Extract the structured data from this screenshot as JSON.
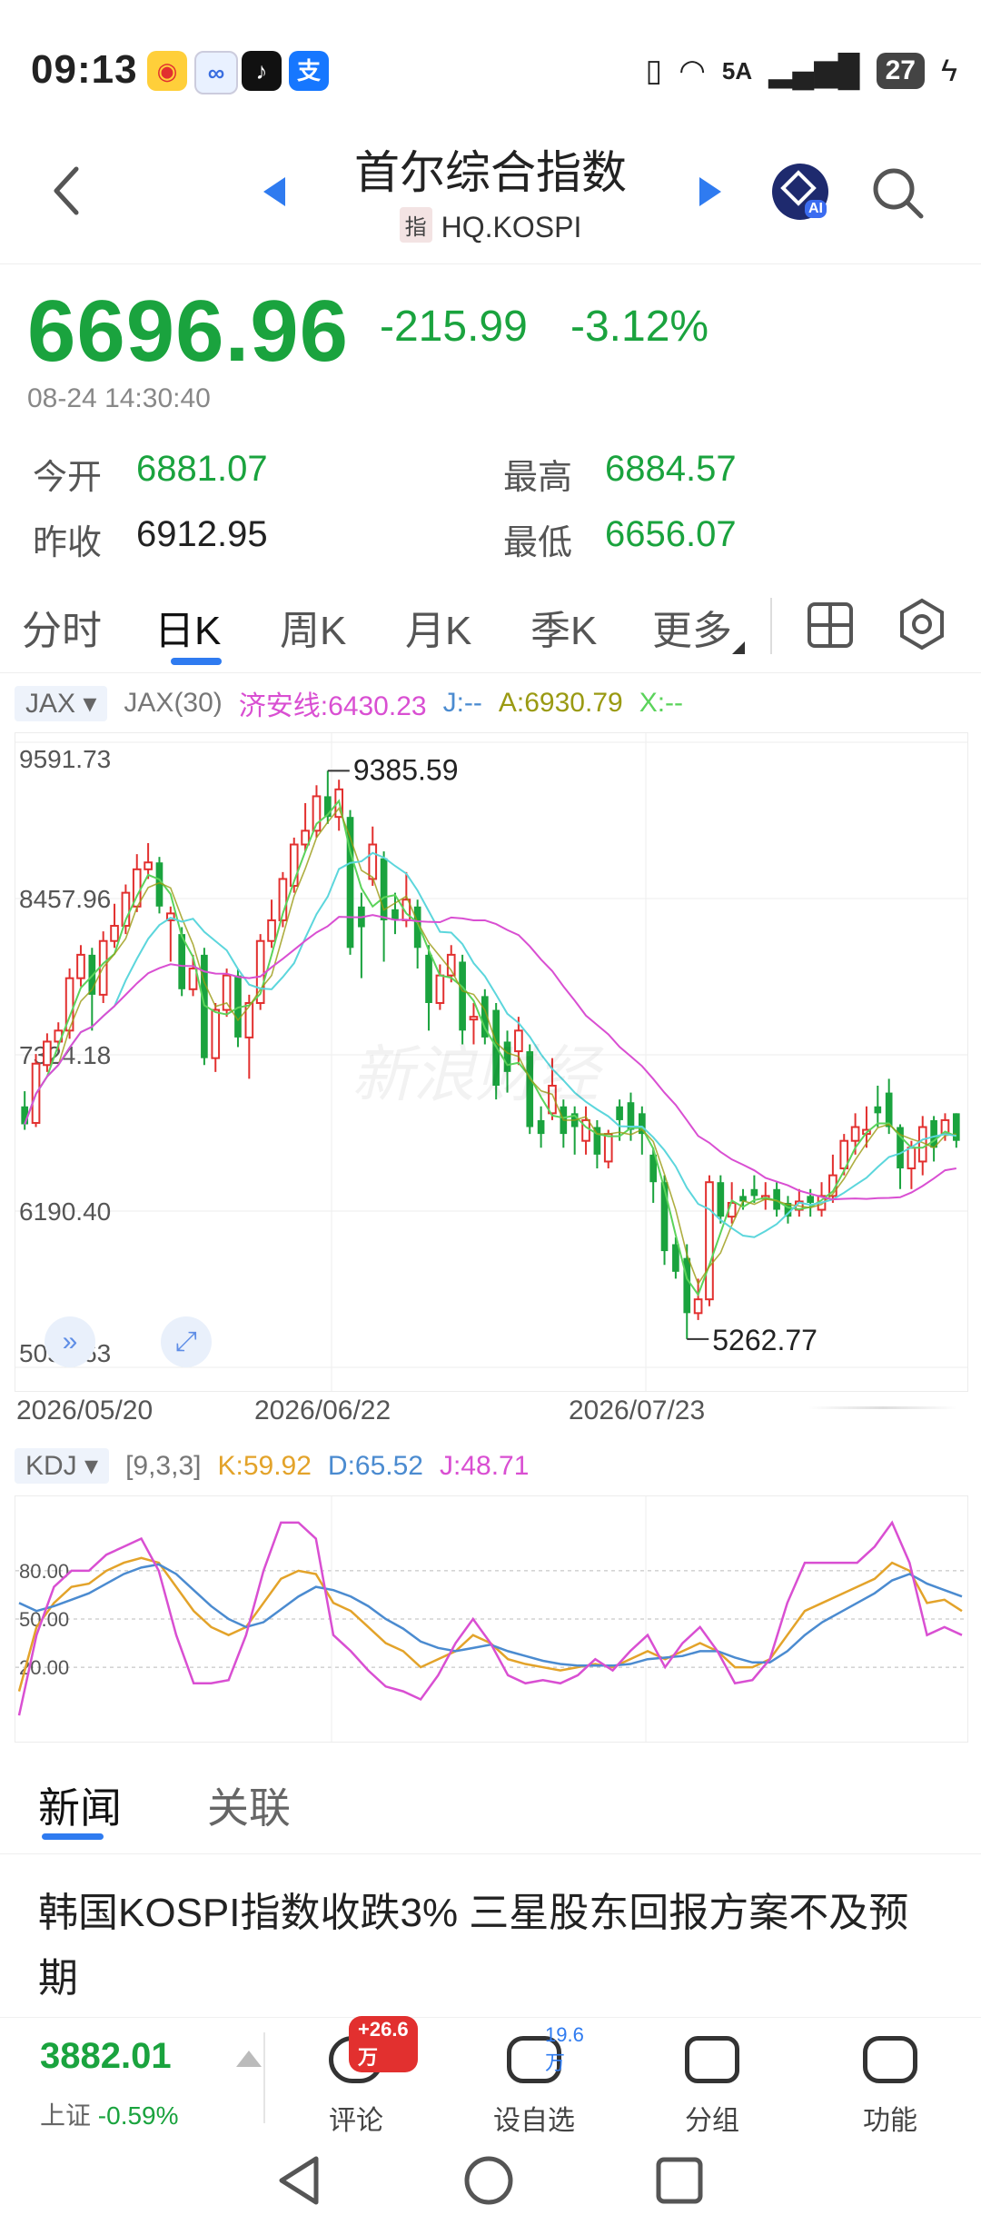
{
  "status": {
    "time": "09:13",
    "network": "5A",
    "battery": "27"
  },
  "header": {
    "title": "首尔综合指数",
    "badge": "指",
    "code": "HQ.KOSPI",
    "ai": "AI"
  },
  "quote": {
    "price": "6696.96",
    "change": "-215.99",
    "change_pct": "-3.12%",
    "datetime": "08-24 14:30:40",
    "open_label": "今开",
    "open": "6881.07",
    "high_label": "最高",
    "high": "6884.57",
    "prev_label": "昨收",
    "prev": "6912.95",
    "low_label": "最低",
    "low": "6656.07"
  },
  "tabs": [
    {
      "label": "分时"
    },
    {
      "label": "日K"
    },
    {
      "label": "周K"
    },
    {
      "label": "月K"
    },
    {
      "label": "季K"
    },
    {
      "label": "更多"
    }
  ],
  "indicator": {
    "name": "JAX ▾",
    "param": "JAX(30)",
    "jian": "济安线:6430.23",
    "j": "J:--",
    "a": "A:6930.79",
    "x": "X:--"
  },
  "kdj": {
    "name": "KDJ ▾",
    "param": "[9,3,3]",
    "k": "K:59.92",
    "d": "D:65.52",
    "j": "J:48.71"
  },
  "chart_data": [
    {
      "type": "candlestick",
      "y_ticks": [
        "9591.73",
        "8457.96",
        "7324.18",
        "6190.40",
        "5056.63"
      ],
      "ylim": [
        5056.63,
        9591.73
      ],
      "x_ticks": [
        "2026/05/20",
        "2026/06/22",
        "2026/07/23"
      ],
      "annotations": [
        "9385.59",
        "5262.77"
      ],
      "series": [
        {
          "o": 6950,
          "c": 6820,
          "h": 7060,
          "l": 6780
        },
        {
          "o": 6830,
          "c": 7260,
          "h": 7330,
          "l": 6800
        },
        {
          "o": 7250,
          "c": 7420,
          "h": 7480,
          "l": 7200
        },
        {
          "o": 7420,
          "c": 7500,
          "h": 7560,
          "l": 7360
        },
        {
          "o": 7500,
          "c": 7880,
          "h": 7950,
          "l": 7440
        },
        {
          "o": 7880,
          "c": 8050,
          "h": 8120,
          "l": 7820
        },
        {
          "o": 8050,
          "c": 7760,
          "h": 8100,
          "l": 7500
        },
        {
          "o": 7760,
          "c": 8150,
          "h": 8220,
          "l": 7700
        },
        {
          "o": 8150,
          "c": 8260,
          "h": 8420,
          "l": 8100
        },
        {
          "o": 8260,
          "c": 8500,
          "h": 8560,
          "l": 8200
        },
        {
          "o": 8400,
          "c": 8670,
          "h": 8780,
          "l": 8360
        },
        {
          "o": 8670,
          "c": 8720,
          "h": 8860,
          "l": 8600
        },
        {
          "o": 8720,
          "c": 8400,
          "h": 8760,
          "l": 8350
        },
        {
          "o": 8300,
          "c": 8350,
          "h": 8400,
          "l": 8000
        },
        {
          "o": 8200,
          "c": 7800,
          "h": 8250,
          "l": 7750
        },
        {
          "o": 7800,
          "c": 7950,
          "h": 8050,
          "l": 7750
        },
        {
          "o": 8050,
          "c": 7300,
          "h": 8100,
          "l": 7250
        },
        {
          "o": 7300,
          "c": 7650,
          "h": 7700,
          "l": 7200
        },
        {
          "o": 7650,
          "c": 7900,
          "h": 7950,
          "l": 7600
        },
        {
          "o": 7900,
          "c": 7450,
          "h": 7950,
          "l": 7380
        },
        {
          "o": 7450,
          "c": 7700,
          "h": 7760,
          "l": 7150
        },
        {
          "o": 7700,
          "c": 8150,
          "h": 8200,
          "l": 7650
        },
        {
          "o": 8150,
          "c": 8300,
          "h": 8450,
          "l": 8100
        },
        {
          "o": 8300,
          "c": 8600,
          "h": 8650,
          "l": 8250
        },
        {
          "o": 8550,
          "c": 8850,
          "h": 8900,
          "l": 8500
        },
        {
          "o": 8850,
          "c": 8950,
          "h": 9150,
          "l": 8800
        },
        {
          "o": 8950,
          "c": 9200,
          "h": 9280,
          "l": 8900
        },
        {
          "o": 9200,
          "c": 9050,
          "h": 9385,
          "l": 9000
        },
        {
          "o": 9050,
          "c": 9250,
          "h": 9320,
          "l": 8950
        },
        {
          "o": 9050,
          "c": 8100,
          "h": 9100,
          "l": 8050
        },
        {
          "o": 8400,
          "c": 8250,
          "h": 8500,
          "l": 7880
        },
        {
          "o": 8600,
          "c": 8850,
          "h": 8980,
          "l": 8550
        },
        {
          "o": 8750,
          "c": 8300,
          "h": 8800,
          "l": 8000
        },
        {
          "o": 8380,
          "c": 8300,
          "h": 8500,
          "l": 8200
        },
        {
          "o": 8300,
          "c": 8450,
          "h": 8650,
          "l": 8250
        },
        {
          "o": 8400,
          "c": 8100,
          "h": 8450,
          "l": 7950
        },
        {
          "o": 8050,
          "c": 7700,
          "h": 8120,
          "l": 7500
        },
        {
          "o": 7700,
          "c": 7900,
          "h": 7980,
          "l": 7650
        },
        {
          "o": 7900,
          "c": 8050,
          "h": 8120,
          "l": 7850
        },
        {
          "o": 8000,
          "c": 7500,
          "h": 8050,
          "l": 7400
        },
        {
          "o": 7600,
          "c": 7600,
          "h": 7700,
          "l": 7400
        },
        {
          "o": 7750,
          "c": 7450,
          "h": 7800,
          "l": 7400
        },
        {
          "o": 7650,
          "c": 7100,
          "h": 7700,
          "l": 7000
        },
        {
          "o": 7420,
          "c": 7200,
          "h": 7500,
          "l": 7050
        },
        {
          "o": 7350,
          "c": 7500,
          "h": 7600,
          "l": 7250
        },
        {
          "o": 7350,
          "c": 6800,
          "h": 7400,
          "l": 6750
        },
        {
          "o": 6850,
          "c": 6750,
          "h": 6950,
          "l": 6650
        },
        {
          "o": 6900,
          "c": 7100,
          "h": 7300,
          "l": 6850
        },
        {
          "o": 6950,
          "c": 6750,
          "h": 7000,
          "l": 6650
        },
        {
          "o": 6900,
          "c": 6800,
          "h": 6950,
          "l": 6600
        },
        {
          "o": 6700,
          "c": 6850,
          "h": 6950,
          "l": 6600
        },
        {
          "o": 6800,
          "c": 6600,
          "h": 6850,
          "l": 6500
        },
        {
          "o": 6550,
          "c": 6750,
          "h": 6780,
          "l": 6500
        },
        {
          "o": 6950,
          "c": 6850,
          "h": 7000,
          "l": 6700
        },
        {
          "o": 6980,
          "c": 6780,
          "h": 7050,
          "l": 6700
        },
        {
          "o": 6900,
          "c": 6750,
          "h": 6950,
          "l": 6600
        },
        {
          "o": 6600,
          "c": 6400,
          "h": 6650,
          "l": 6250
        },
        {
          "o": 6400,
          "c": 5900,
          "h": 6450,
          "l": 5800
        },
        {
          "o": 5950,
          "c": 5750,
          "h": 6000,
          "l": 5700
        },
        {
          "o": 5850,
          "c": 5450,
          "h": 5950,
          "l": 5262
        },
        {
          "o": 5450,
          "c": 5550,
          "h": 5700,
          "l": 5400
        },
        {
          "o": 5550,
          "c": 6400,
          "h": 6450,
          "l": 5500
        },
        {
          "o": 6400,
          "c": 6150,
          "h": 6450,
          "l": 6100
        },
        {
          "o": 6150,
          "c": 6250,
          "h": 6400,
          "l": 6100
        },
        {
          "o": 6300,
          "c": 6260,
          "h": 6350,
          "l": 6200
        },
        {
          "o": 6350,
          "c": 6300,
          "h": 6450,
          "l": 6250
        },
        {
          "o": 6300,
          "c": 6300,
          "h": 6400,
          "l": 6200
        },
        {
          "o": 6350,
          "c": 6200,
          "h": 6400,
          "l": 6150
        },
        {
          "o": 6250,
          "c": 6150,
          "h": 6300,
          "l": 6100
        },
        {
          "o": 6200,
          "c": 6260,
          "h": 6350,
          "l": 6150
        },
        {
          "o": 6300,
          "c": 6250,
          "h": 6350,
          "l": 6150
        },
        {
          "o": 6200,
          "c": 6300,
          "h": 6400,
          "l": 6150
        },
        {
          "o": 6300,
          "c": 6450,
          "h": 6600,
          "l": 6250
        },
        {
          "o": 6500,
          "c": 6700,
          "h": 6750,
          "l": 6450
        },
        {
          "o": 6700,
          "c": 6800,
          "h": 6900,
          "l": 6600
        },
        {
          "o": 6750,
          "c": 6780,
          "h": 6950,
          "l": 6650
        },
        {
          "o": 6950,
          "c": 6900,
          "h": 7100,
          "l": 6800
        },
        {
          "o": 7050,
          "c": 6800,
          "h": 7150,
          "l": 6750
        },
        {
          "o": 6800,
          "c": 6500,
          "h": 6820,
          "l": 6350
        },
        {
          "o": 6500,
          "c": 6650,
          "h": 6700,
          "l": 6350
        },
        {
          "o": 6550,
          "c": 6800,
          "h": 6880,
          "l": 6450
        },
        {
          "o": 6850,
          "c": 6650,
          "h": 6880,
          "l": 6550
        },
        {
          "o": 6750,
          "c": 6850,
          "h": 6900,
          "l": 6700
        },
        {
          "o": 6900,
          "c": 6700,
          "h": 6900,
          "l": 6650
        }
      ]
    },
    {
      "type": "line",
      "ylim": [
        0,
        100
      ],
      "y_ticks": [
        "80.00",
        "50.00",
        "20.00"
      ],
      "series": [
        {
          "name": "K",
          "values": [
            5,
            45,
            60,
            70,
            72,
            80,
            85,
            88,
            85,
            70,
            55,
            45,
            40,
            45,
            60,
            75,
            80,
            78,
            60,
            55,
            45,
            35,
            30,
            20,
            25,
            30,
            40,
            35,
            25,
            22,
            20,
            18,
            20,
            22,
            20,
            25,
            30,
            25,
            30,
            35,
            30,
            20,
            20,
            25,
            40,
            55,
            60,
            65,
            70,
            75,
            85,
            80,
            60,
            62,
            55
          ]
        },
        {
          "name": "D",
          "values": [
            60,
            55,
            58,
            62,
            66,
            72,
            78,
            82,
            84,
            78,
            68,
            58,
            50,
            45,
            48,
            56,
            64,
            70,
            68,
            64,
            58,
            50,
            44,
            36,
            32,
            30,
            32,
            34,
            30,
            27,
            24,
            22,
            21,
            21,
            21,
            22,
            25,
            26,
            27,
            30,
            30,
            26,
            23,
            23,
            30,
            40,
            48,
            54,
            60,
            66,
            74,
            78,
            72,
            68,
            64
          ]
        },
        {
          "name": "J",
          "values": [
            -10,
            40,
            70,
            80,
            80,
            90,
            95,
            100,
            80,
            40,
            10,
            10,
            12,
            40,
            80,
            110,
            110,
            100,
            40,
            30,
            18,
            8,
            5,
            0,
            15,
            35,
            50,
            35,
            15,
            10,
            12,
            10,
            15,
            25,
            18,
            30,
            40,
            20,
            35,
            45,
            30,
            10,
            12,
            25,
            60,
            85,
            85,
            85,
            85,
            95,
            110,
            85,
            40,
            45,
            40
          ]
        }
      ]
    }
  ],
  "news_tabs": [
    {
      "label": "新闻"
    },
    {
      "label": "关联"
    }
  ],
  "news": {
    "headline": "韩国KOSPI指数收跌3% 三星股东回报方案不及预期"
  },
  "footer": {
    "index_price": "3882.01",
    "index_name": "上证",
    "index_pct": "-0.59%",
    "comment_badge": "+26.6万",
    "comment_label": "评论",
    "watch_count": "19.6万",
    "watch_label": "设自选",
    "group_label": "分组",
    "func_label": "功能"
  },
  "watermark": "新浪财经",
  "colors": {
    "up": "#e2302f",
    "down": "#1aa33e",
    "accent": "#2f7bf0",
    "jian": "#d94fd2",
    "a_line": "#9a9a12",
    "x_line": "#5bd35b",
    "ma": "#5cd6dc",
    "k": "#e3a32a",
    "d": "#4b8bd0",
    "j": "#d94fd2"
  }
}
